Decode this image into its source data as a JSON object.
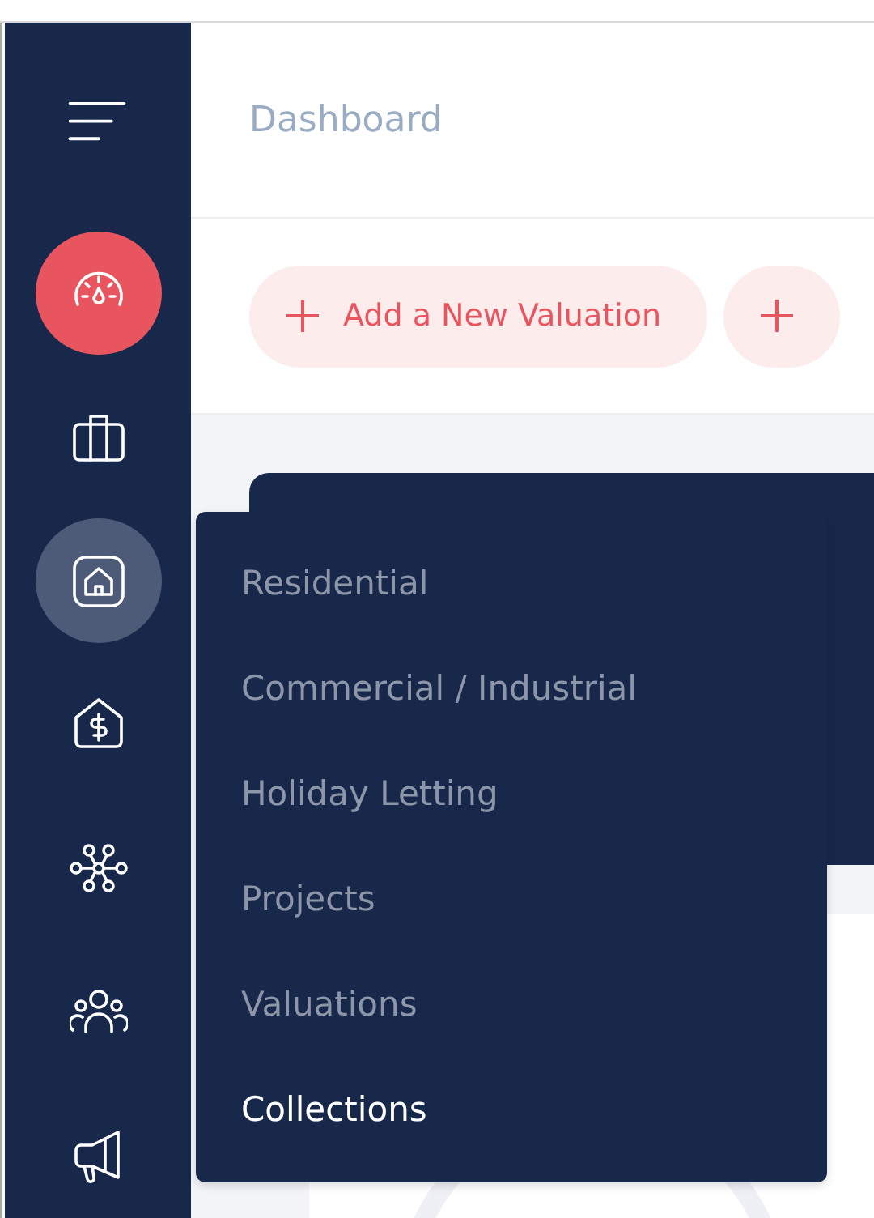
{
  "header": {
    "title": "Dashboard"
  },
  "actions": [
    {
      "kind": "labeled",
      "label": "Add a New Valuation"
    },
    {
      "kind": "icon"
    }
  ],
  "sidebar": {
    "items": [
      {
        "selected": true,
        "expanded": false
      },
      {
        "selected": false,
        "expanded": false
      },
      {
        "selected": false,
        "expanded": true
      },
      {
        "selected": false,
        "expanded": false
      },
      {
        "selected": false,
        "expanded": false
      },
      {
        "selected": false,
        "expanded": false
      },
      {
        "selected": false,
        "expanded": false
      }
    ]
  },
  "submenu": {
    "items": [
      {
        "label": "Residential",
        "selected": false
      },
      {
        "label": "Commercial / Industrial",
        "selected": false
      },
      {
        "label": "Holiday Letting",
        "selected": false
      },
      {
        "label": "Projects",
        "selected": false
      },
      {
        "label": "Valuations",
        "selected": false
      },
      {
        "label": "Collections",
        "selected": true
      }
    ]
  }
}
